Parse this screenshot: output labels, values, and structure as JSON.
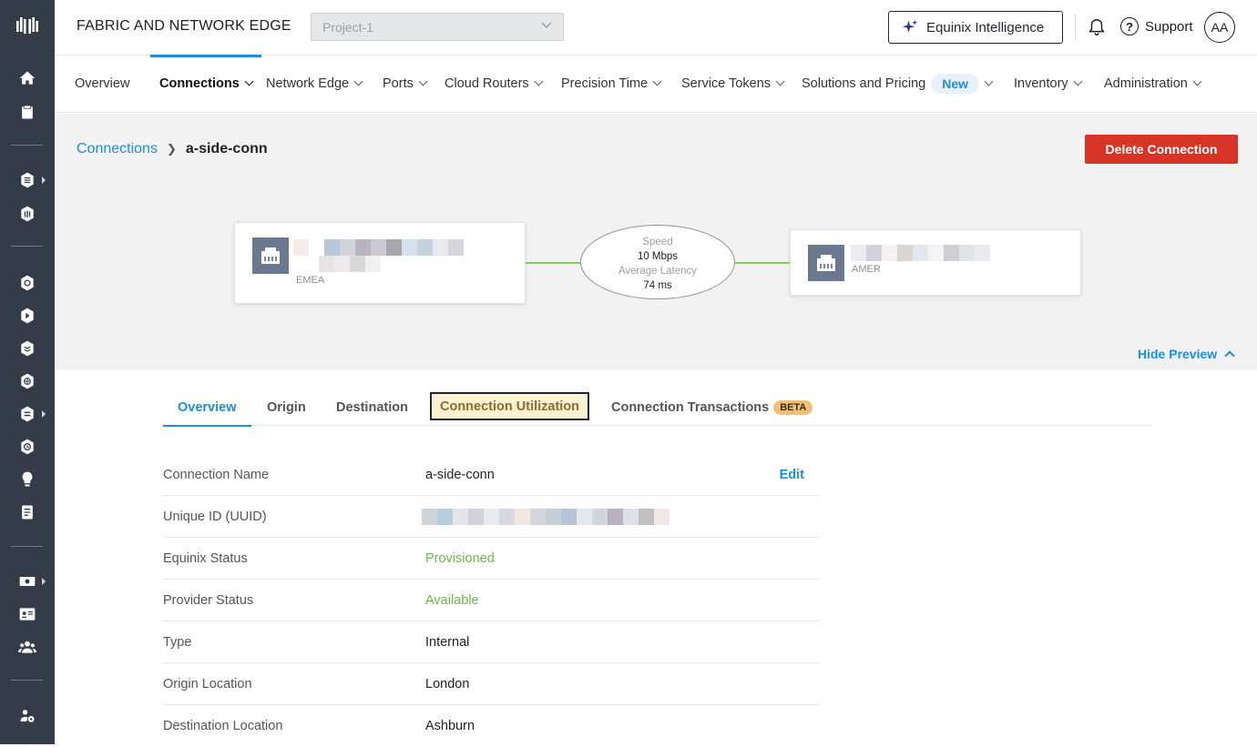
{
  "header": {
    "app_title": "FABRIC AND NETWORK EDGE",
    "project": "Project-1",
    "ai_button": "Equinix Intelligence",
    "support": "Support",
    "avatar_initials": "AA"
  },
  "nav": {
    "items": [
      {
        "label": "Overview"
      },
      {
        "label": "Connections"
      },
      {
        "label": "Network Edge"
      },
      {
        "label": "Ports"
      },
      {
        "label": "Cloud Routers"
      },
      {
        "label": "Precision Time"
      },
      {
        "label": "Service Tokens"
      },
      {
        "label": "Solutions and Pricing"
      },
      {
        "label": "Inventory"
      },
      {
        "label": "Administration"
      }
    ],
    "new_badge": "New"
  },
  "preview": {
    "breadcrumb_parent": "Connections",
    "breadcrumb_current": "a-side-conn",
    "delete_button": "Delete Connection",
    "a_side_region": "EMEA",
    "z_side_region": "AMER",
    "speed_label": "Speed",
    "speed_value": "10 Mbps",
    "latency_label": "Average Latency",
    "latency_value": "74 ms",
    "hide_preview": "Hide Preview"
  },
  "tabs": {
    "overview": "Overview",
    "origin": "Origin",
    "destination": "Destination",
    "utilization": "Connection Utilization",
    "transactions": "Connection Transactions",
    "beta": "BETA"
  },
  "details": {
    "edit": "Edit",
    "rows": [
      {
        "key": "Connection Name",
        "value": "a-side-conn"
      },
      {
        "key": "Unique ID (UUID)",
        "value": ""
      },
      {
        "key": "Equinix Status",
        "value": "Provisioned"
      },
      {
        "key": "Provider Status",
        "value": "Available"
      },
      {
        "key": "Type",
        "value": "Internal"
      },
      {
        "key": "Origin Location",
        "value": "London"
      },
      {
        "key": "Destination Location",
        "value": "Ashburn"
      }
    ]
  },
  "colors": {
    "sidebar": "#333c48",
    "accent": "#1d8ddd",
    "danger": "#d63427",
    "success": "#6eb64a"
  }
}
